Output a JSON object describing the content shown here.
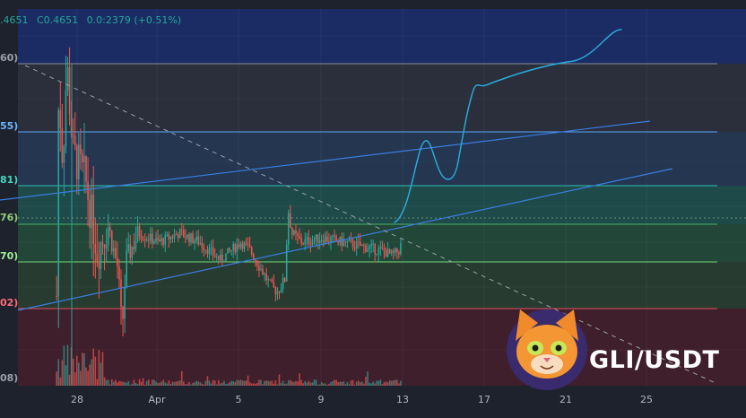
{
  "header": {
    "open_fragment": ".4651",
    "close": "C0.4651",
    "change": "0.0:2379 (+0.51%)"
  },
  "levels": [
    {
      "label": "60)",
      "color": "#9aa0aa"
    },
    {
      "label": "55)",
      "color": "#6fb4ff"
    },
    {
      "label": "81)",
      "color": "#45d6c2"
    },
    {
      "label": "76)",
      "color": "#8fd07a"
    },
    {
      "label": "70)",
      "color": "#9cf09a"
    },
    {
      "label": "02)",
      "color": "#ff6b7a"
    },
    {
      "label": "08)",
      "color": "#9aa0aa"
    }
  ],
  "zone_colors": [
    "#1a2c63",
    "#2b2e3b",
    "#243650",
    "#1f4a4a",
    "#224638",
    "#283b30",
    "#401f2c"
  ],
  "colors": {
    "up": "#26a69a",
    "down": "#ef5350",
    "trend": "#3b7de0",
    "drawing": "#2aa8d8"
  },
  "x_axis": {
    "ticks": [
      "28",
      "Apr",
      "5",
      "9",
      "13",
      "17",
      "21",
      "25"
    ]
  },
  "brand": {
    "pair": "GLI/USDT",
    "logo": "cat-face-logo"
  },
  "chart_data": {
    "type": "candlestick",
    "title": "",
    "xlabel": "",
    "ylabel": "",
    "x_ticks": [
      "28",
      "Apr",
      "5",
      "9",
      "13",
      "17",
      "21",
      "25"
    ],
    "grid": true,
    "series": [
      {
        "values": [
          {
            "d": 27.0,
            "v": 0.4
          },
          {
            "d": 27.1,
            "v": 0.63
          },
          {
            "d": 27.3,
            "v": 0.55
          },
          {
            "d": 27.5,
            "v": 0.66
          },
          {
            "d": 27.8,
            "v": 0.56
          },
          {
            "d": 28.4,
            "v": 0.53
          },
          {
            "d": 29.0,
            "v": 0.45
          },
          {
            "d": 29.5,
            "v": 0.48
          },
          {
            "d": 30.0,
            "v": 0.43
          },
          {
            "d": 30.2,
            "v": 0.36
          },
          {
            "d": 30.4,
            "v": 0.44
          },
          {
            "d": 31.0,
            "v": 0.47
          },
          {
            "d": 32.0,
            "v": 0.46
          },
          {
            "d": 33.0,
            "v": 0.47
          },
          {
            "d": 34.0,
            "v": 0.46
          },
          {
            "d": 35.0,
            "v": 0.44
          },
          {
            "d": 36.0,
            "v": 0.46
          },
          {
            "d": 36.5,
            "v": 0.45
          },
          {
            "d": 37.0,
            "v": 0.43
          },
          {
            "d": 37.5,
            "v": 0.41
          },
          {
            "d": 37.8,
            "v": 0.405
          },
          {
            "d": 38.2,
            "v": 0.42
          },
          {
            "d": 38.3,
            "v": 0.5
          },
          {
            "d": 38.5,
            "v": 0.47
          },
          {
            "d": 39.0,
            "v": 0.46
          },
          {
            "d": 40.0,
            "v": 0.465
          },
          {
            "d": 41.0,
            "v": 0.46
          },
          {
            "d": 42.0,
            "v": 0.455
          },
          {
            "d": 43.0,
            "v": 0.45
          },
          {
            "d": 43.4,
            "v": 0.445
          },
          {
            "d": 43.8,
            "v": 0.452
          },
          {
            "d": 43.9,
            "v": 0.4651
          }
        ]
      }
    ]
  }
}
